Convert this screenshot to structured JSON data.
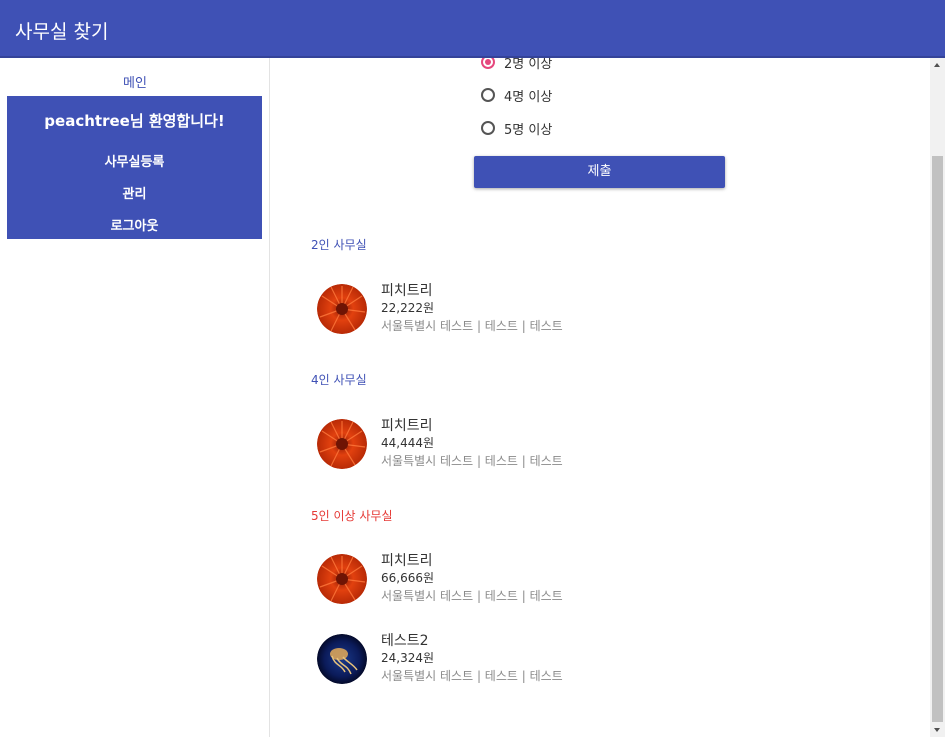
{
  "appbar": {
    "title": "사무실 찾기"
  },
  "sidebar": {
    "main_link": "메인",
    "welcome": "peachtree님 환영합니다!",
    "items": [
      {
        "label": "사무실등록"
      },
      {
        "label": "관리"
      },
      {
        "label": "로그아웃"
      }
    ]
  },
  "filter": {
    "options": [
      {
        "label": "2명 이상",
        "checked": true
      },
      {
        "label": "4명 이상",
        "checked": false
      },
      {
        "label": "5명 이상",
        "checked": false
      }
    ],
    "submit_label": "제출"
  },
  "sections": [
    {
      "title": "2인 사무실",
      "color": "#3f51b5",
      "items": [
        {
          "name": "피치트리",
          "price": "22,222원",
          "address": "서울특별시 테스트 | 테스트 | 테스트",
          "image": "red-flower"
        }
      ]
    },
    {
      "title": "4인 사무실",
      "color": "#3f51b5",
      "items": [
        {
          "name": "피치트리",
          "price": "44,444원",
          "address": "서울특별시 테스트 | 테스트 | 테스트",
          "image": "red-flower"
        }
      ]
    },
    {
      "title": "5인 이상 사무실",
      "color": "#e53935",
      "items": [
        {
          "name": "피치트리",
          "price": "66,666원",
          "address": "서울특별시 테스트 | 테스트 | 테스트",
          "image": "red-flower"
        },
        {
          "name": "테스트2",
          "price": "24,324원",
          "address": "서울특별시 테스트 | 테스트 | 테스트",
          "image": "jellyfish"
        }
      ]
    }
  ],
  "colors": {
    "primary": "#3f51b5",
    "accent": "#e5477d",
    "section_red": "#e53935"
  }
}
